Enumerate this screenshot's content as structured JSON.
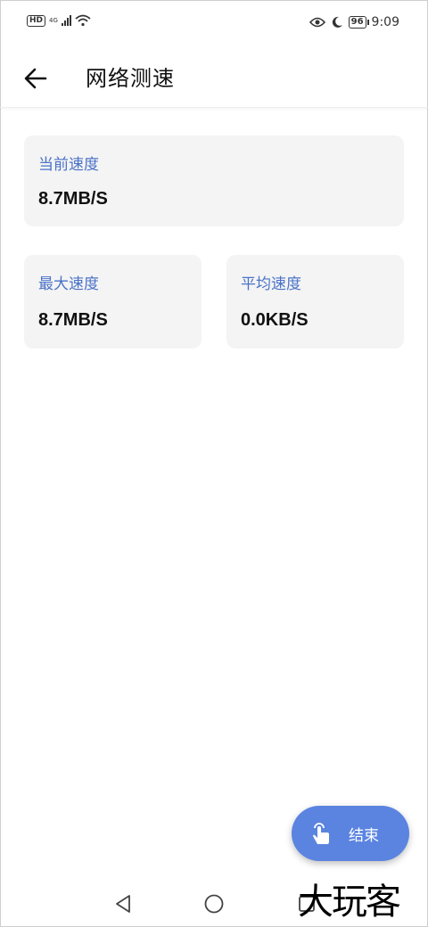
{
  "status_bar": {
    "hd": "HD",
    "network": "4G",
    "battery": "96",
    "time": "9:09",
    "icons": [
      "hd-icon",
      "signal-icon",
      "wifi-icon",
      "eye-icon",
      "moon-icon",
      "battery-icon"
    ]
  },
  "app_bar": {
    "title": "网络测速",
    "back_icon": "arrow-left-icon"
  },
  "stats": {
    "current": {
      "label": "当前速度",
      "value": "8.7MB/S"
    },
    "max": {
      "label": "最大速度",
      "value": "8.7MB/S"
    },
    "average": {
      "label": "平均速度",
      "value": "0.0KB/S"
    }
  },
  "fab": {
    "label": "结束",
    "icon": "touch-icon",
    "color": "#5a84e0"
  },
  "nav_bar": {
    "icons": [
      "back-triangle-icon",
      "home-circle-icon",
      "recents-square-icon"
    ]
  },
  "watermark": "大玩客",
  "colors": {
    "label": "#4a72c8",
    "card_bg": "#f4f4f4"
  }
}
